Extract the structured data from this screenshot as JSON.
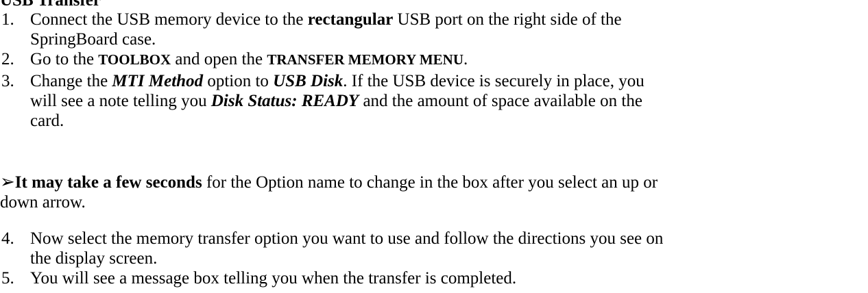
{
  "heading": "USB Transfer",
  "steps": [
    {
      "num": "1.",
      "parts": [
        "Connect the USB memory device to the ",
        "rectangular",
        " USB port on the right side of the",
        "SpringBoard case."
      ]
    },
    {
      "num": "2.",
      "parts": [
        "Go to the ",
        "TOOLBOX",
        " and open the ",
        "TRANSFER MEMORY MENU",
        "."
      ]
    },
    {
      "num": "3.",
      "parts": [
        "Change the ",
        "MTI Method",
        " option to ",
        "USB Disk",
        ".  If the USB device is securely in place, you",
        "will see a note telling you ",
        "Disk Status:  READY",
        " and the amount of space available on the",
        "card."
      ]
    },
    {
      "num": "4.",
      "parts": [
        "Now select the memory transfer option you want to use and follow the directions you see on",
        "the display screen."
      ]
    },
    {
      "num": "5.",
      "parts": [
        "You will see a message box telling you when the transfer is completed."
      ]
    }
  ],
  "note": {
    "icon": "right-arrow-icon",
    "bold_lead": "It may take a few seconds",
    "rest_line1": " for the Option name to change in the box after you select an up or",
    "rest_line2": "down arrow."
  }
}
